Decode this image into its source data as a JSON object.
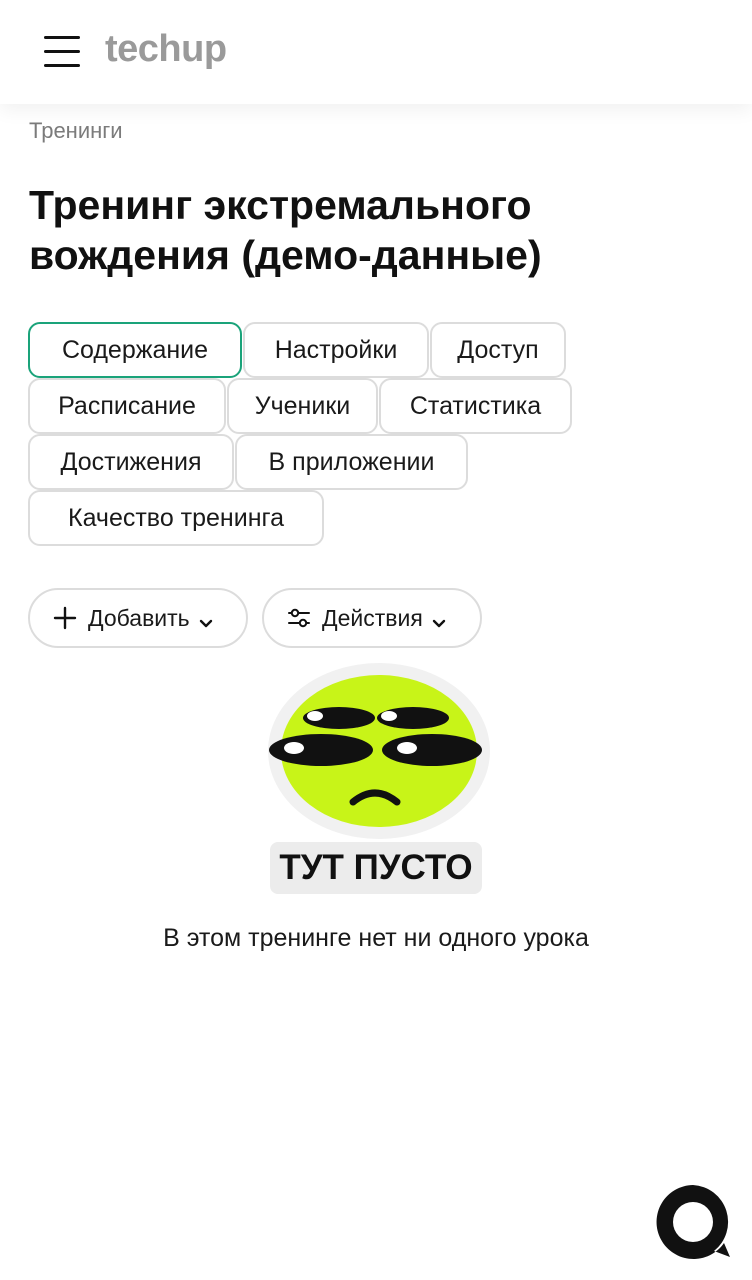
{
  "header": {
    "logo": "techup",
    "menu_icon": "hamburger-icon"
  },
  "breadcrumb": "Тренинги",
  "page_title": "Тренинг экстремального вождения (демо-данные)",
  "tabs": [
    {
      "label": "Содержание",
      "active": true
    },
    {
      "label": "Настройки",
      "active": false
    },
    {
      "label": "Доступ",
      "active": false
    },
    {
      "label": "Расписание",
      "active": false
    },
    {
      "label": "Ученики",
      "active": false
    },
    {
      "label": "Статистика",
      "active": false
    },
    {
      "label": "Достижения",
      "active": false
    },
    {
      "label": "В приложении",
      "active": false
    },
    {
      "label": "Качество тренинга",
      "active": false
    }
  ],
  "actions": {
    "add_label": "Добавить",
    "add_icon": "plus-icon",
    "actions_label": "Действия",
    "actions_icon": "sliders-icon"
  },
  "empty_state": {
    "title": "ТУТ ПУСТО",
    "text": "В этом тренинге нет ни одного урока",
    "illustration": "sad-alien-icon"
  },
  "chat": {
    "icon": "chat-bubble-icon"
  },
  "colors": {
    "accent": "#1aa37a",
    "logo": "#9a9a9a",
    "alien": "#c8f418"
  }
}
